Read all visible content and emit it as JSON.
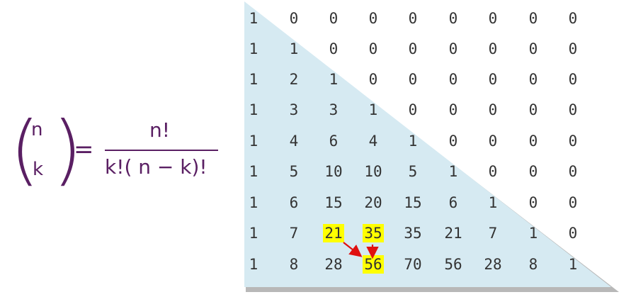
{
  "formula": {
    "paren_left": "(",
    "paren_right": ")",
    "top": "n",
    "bottom": "k",
    "equals": "=",
    "numerator": "n!",
    "denominator": "k!( n − k)!",
    "color": "#5a1f63"
  },
  "table": {
    "rows": [
      [
        "1",
        "0",
        "0",
        "0",
        "0",
        "0",
        "0",
        "0",
        "0"
      ],
      [
        "1",
        "1",
        "0",
        "0",
        "0",
        "0",
        "0",
        "0",
        "0"
      ],
      [
        "1",
        "2",
        "1",
        "0",
        "0",
        "0",
        "0",
        "0",
        "0"
      ],
      [
        "1",
        "3",
        "3",
        "1",
        "0",
        "0",
        "0",
        "0",
        "0"
      ],
      [
        "1",
        "4",
        "6",
        "4",
        "1",
        "0",
        "0",
        "0",
        "0"
      ],
      [
        "1",
        "5",
        "10",
        "10",
        "5",
        "1",
        "0",
        "0",
        "0"
      ],
      [
        "1",
        "6",
        "15",
        "20",
        "15",
        "6",
        "1",
        "0",
        "0"
      ],
      [
        "1",
        "7",
        "21",
        "35",
        "35",
        "21",
        "7",
        "1",
        "0"
      ],
      [
        "1",
        "8",
        "28",
        "56",
        "70",
        "56",
        "28",
        "8",
        "1"
      ]
    ],
    "highlighted": [
      [
        7,
        2
      ],
      [
        7,
        3
      ],
      [
        8,
        3
      ]
    ],
    "highlight_color": "#ffff00",
    "triangle_color": "#d6eaf2",
    "arrow_color": "#e01010"
  }
}
